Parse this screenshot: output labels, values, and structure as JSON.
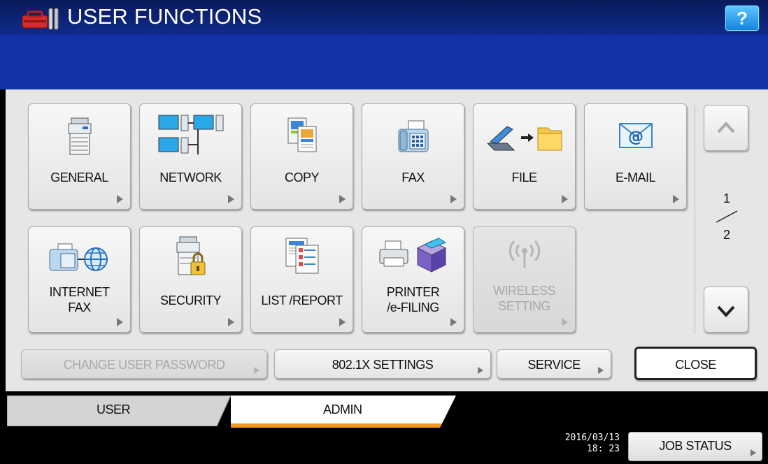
{
  "header": {
    "title": "USER FUNCTIONS",
    "help_label": "?",
    "app_icon": "toolbox-icon"
  },
  "tiles": {
    "general": {
      "label": "GENERAL",
      "icon": "copier-icon"
    },
    "network": {
      "label": "NETWORK",
      "icon": "network-icon"
    },
    "copy": {
      "label": "COPY",
      "icon": "copy-icon"
    },
    "fax": {
      "label": "FAX",
      "icon": "fax-icon"
    },
    "file": {
      "label": "FILE",
      "icon": "scan-to-folder-icon"
    },
    "email": {
      "label": "E-MAIL",
      "icon": "email-icon"
    },
    "internet_fax": {
      "line1": "INTERNET",
      "line2": "FAX",
      "icon": "internet-fax-icon"
    },
    "security": {
      "label": "SECURITY",
      "icon": "security-copier-icon"
    },
    "list_report": {
      "label": "LIST /REPORT",
      "icon": "list-report-icon"
    },
    "printer": {
      "line1": "PRINTER",
      "line2": "/e-FILING",
      "icon": "printer-box-icon"
    },
    "wireless": {
      "line1": "WIRELESS",
      "line2": "SETTING",
      "icon": "wireless-icon",
      "disabled": true
    }
  },
  "pager": {
    "current": "1",
    "total": "2"
  },
  "bottom_buttons": {
    "change_password": "CHANGE USER PASSWORD",
    "dot1x": "802.1X SETTINGS",
    "service": "SERVICE",
    "close": "CLOSE"
  },
  "tabs": {
    "user": "USER",
    "admin": "ADMIN",
    "active": "ADMIN"
  },
  "status": {
    "date": "2016/03/13",
    "time": "18: 23",
    "job_status": "JOB STATUS"
  },
  "colors": {
    "header": "#1232a8",
    "panel": "#e6e6e6",
    "tab_accent": "#f29a1f"
  }
}
